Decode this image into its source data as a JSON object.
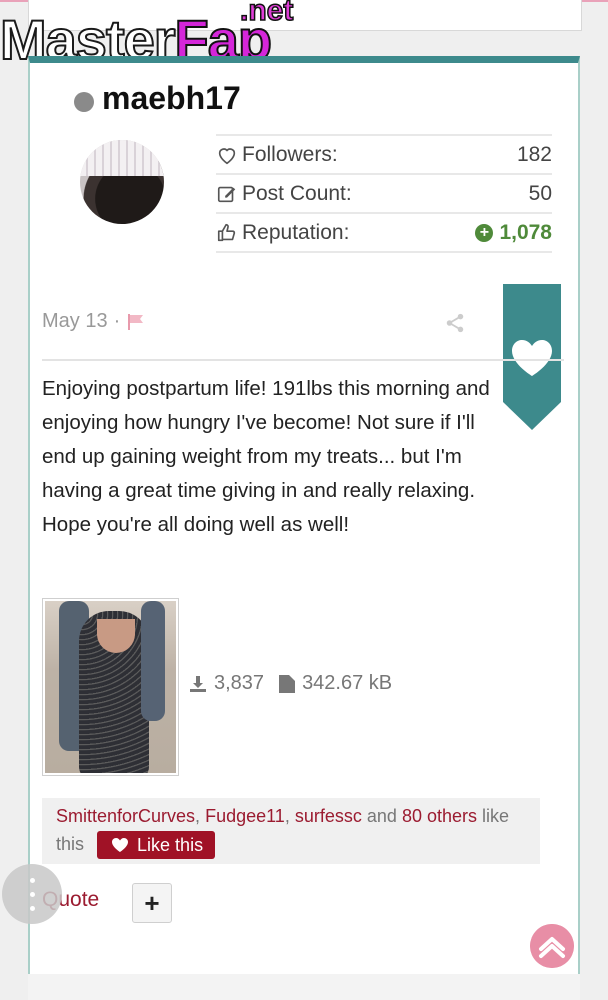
{
  "site": {
    "logo_main": "Master",
    "logo_accent": "Fap",
    "logo_tld": ".net"
  },
  "user": {
    "name": "maebh17",
    "status_color": "#8a8a8a",
    "stats": [
      {
        "icon": "heart-outline-icon",
        "label": "Followers:",
        "value": "182"
      },
      {
        "icon": "edit-icon",
        "label": "Post Count:",
        "value": "50"
      },
      {
        "icon": "thumbs-up-icon",
        "label": "Reputation:",
        "value": "1,078"
      }
    ]
  },
  "post": {
    "date": "May 13",
    "separator": "·",
    "body": "Enjoying postpartum life! 191lbs this morning and enjoying how hungry I've become! Not sure if I'll end up gaining weight from my treats... but I'm having a great time giving in and really relaxing. Hope you're all doing well as well!",
    "attachment": {
      "downloads": "3,837",
      "size": "342.67 kB"
    }
  },
  "likes": {
    "users": [
      "SmittenforCurves",
      "Fudgee11",
      "surfessc"
    ],
    "comma": ",",
    "and_text": "and",
    "others": "80 others",
    "suffix": "like this",
    "button_label": "Like this"
  },
  "actions": {
    "quote": "Quote",
    "plus": "+"
  },
  "colors": {
    "accent": "#3d8a8c",
    "link": "#9b1b30",
    "like_button": "#a01226",
    "reputation": "#4f8a3a",
    "scroll_top": "#e88ea6"
  }
}
